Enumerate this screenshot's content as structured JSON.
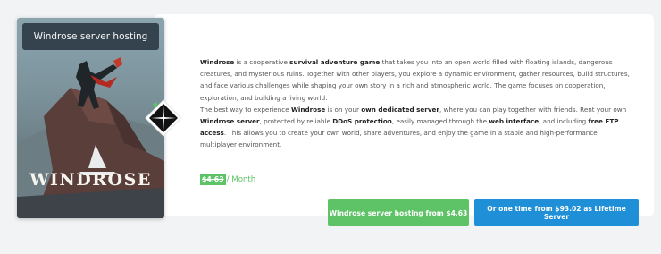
{
  "cover": {
    "title": "Windrose server hosting",
    "wordmark": "WINDROSE"
  },
  "description": {
    "p1": [
      {
        "t": "Windrose",
        "b": true
      },
      {
        "t": " is a cooperative ",
        "b": false
      },
      {
        "t": "survival adventure game",
        "b": true
      },
      {
        "t": " that takes you into an open world filled with floating islands, dangerous creatures, and mysterious ruins. Together with other players, you explore a dynamic environment, gather resources, build structures, and face various challenges while shaping your own story in a rich and atmospheric world. The game focuses on cooperation, exploration, and building a living world.",
        "b": false
      }
    ],
    "p2": [
      {
        "t": "The best way to experience ",
        "b": false
      },
      {
        "t": "Windrose",
        "b": true
      },
      {
        "t": " is on your ",
        "b": false
      },
      {
        "t": "own dedicated server",
        "b": true
      },
      {
        "t": ", where you can play together with friends. Rent your own ",
        "b": false
      },
      {
        "t": "Windrose server",
        "b": true
      },
      {
        "t": ", protected by reliable ",
        "b": false
      },
      {
        "t": "DDoS protection",
        "b": true
      },
      {
        "t": ", easily managed through the ",
        "b": false
      },
      {
        "t": "web interface",
        "b": true
      },
      {
        "t": ", and including ",
        "b": false
      },
      {
        "t": "free FTP access",
        "b": true
      },
      {
        "t": ". This allows you to create your own world, share adventures, and enjoy the game in a stable and high-performance multiplayer environment.",
        "b": false
      }
    ]
  },
  "price": {
    "amount": "$4.63",
    "period": "/ Month"
  },
  "buttons": {
    "monthly": "Windrose server hosting from $4.63",
    "lifetime": "Or one time from $93.02 as Lifetime Server"
  },
  "colors": {
    "green": "#5ec266",
    "blue": "#1f8fd8",
    "cover_title_bg": "#34434d"
  }
}
